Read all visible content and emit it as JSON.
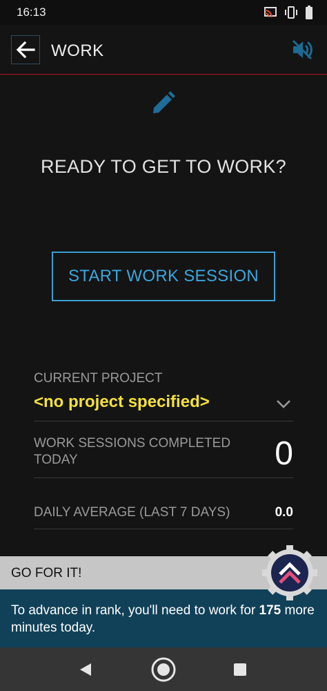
{
  "status_bar": {
    "time": "16:13",
    "icons": [
      "cast-icon",
      "vibrate-icon",
      "battery-icon"
    ]
  },
  "app_bar": {
    "title": "WORK",
    "back_icon": "arrow-left-icon",
    "mute_icon": "volume-off-icon",
    "divider_color": "#b1151f"
  },
  "main": {
    "header_icon": "pencil-icon",
    "prompt": "READY TO GET TO WORK?",
    "start_button_label": "START WORK SESSION",
    "accent_color": "#3aa7e0"
  },
  "stats": {
    "current_project": {
      "label": "CURRENT PROJECT",
      "value": "<no project specified>",
      "value_color": "#f4e13b"
    },
    "sessions_today": {
      "label": "WORK SESSIONS COMPLETED TODAY",
      "value": "0"
    },
    "daily_average": {
      "label": "DAILY AVERAGE (LAST 7 DAYS)",
      "value": "0.0"
    }
  },
  "banner": {
    "heading": "GO FOR IT!",
    "message_before": "To advance in rank, you'll need to work for ",
    "minutes": "175",
    "message_after": " more minutes today.",
    "badge_icon": "rank-badge-icon",
    "background_color": "#114158"
  },
  "nav_bar": {
    "icons": [
      "nav-back-icon",
      "nav-home-icon",
      "nav-recents-icon"
    ]
  }
}
